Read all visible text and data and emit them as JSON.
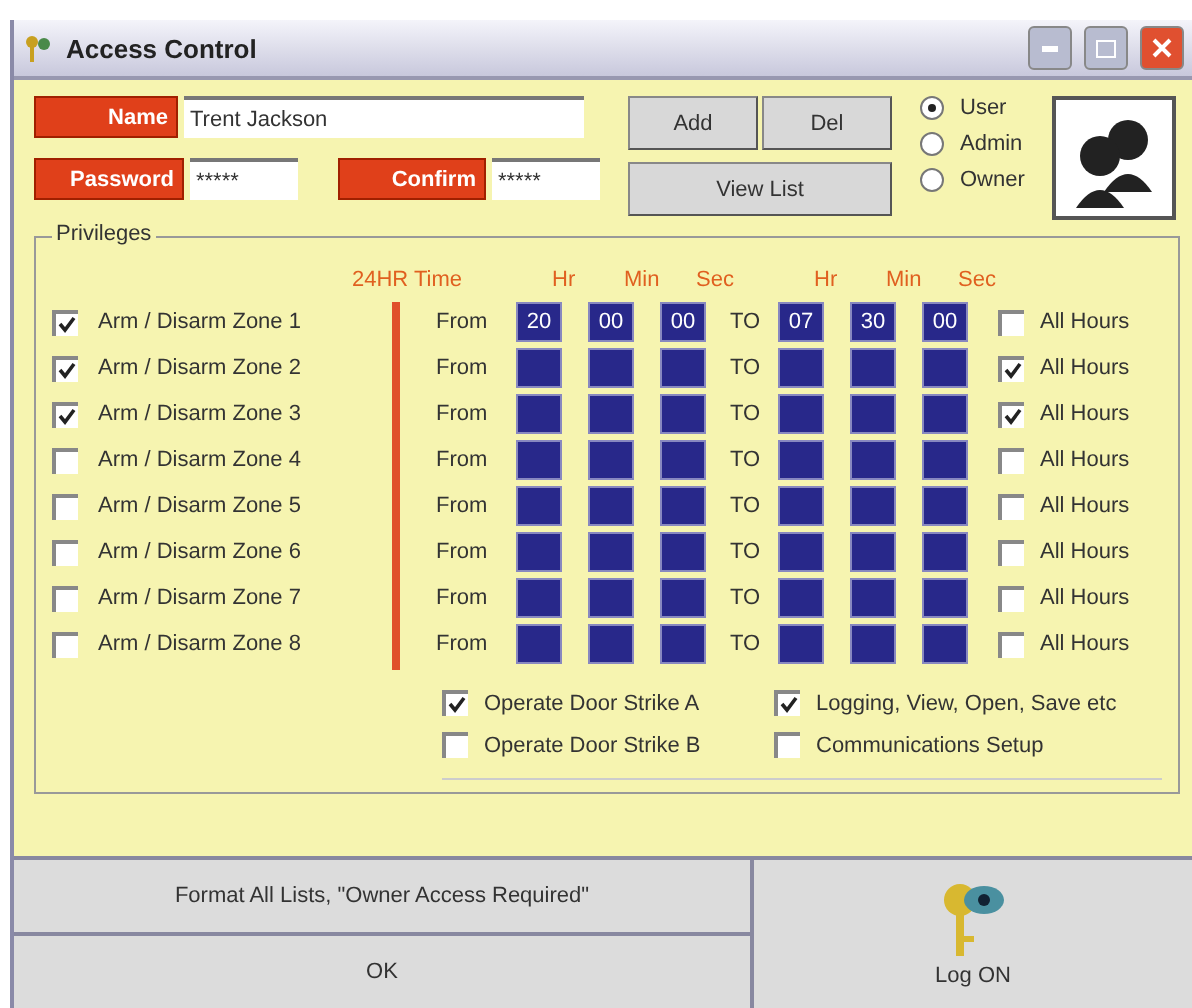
{
  "window": {
    "title": "Access Control"
  },
  "user": {
    "name_label": "Name",
    "name": "Trent Jackson",
    "password_label": "Password",
    "password": "*****",
    "confirm_label": "Confirm",
    "confirm": "*****"
  },
  "buttons": {
    "add": "Add",
    "del": "Del",
    "view_list": "View List"
  },
  "roles": [
    {
      "label": "User",
      "selected": true
    },
    {
      "label": "Admin",
      "selected": false
    },
    {
      "label": "Owner",
      "selected": false
    }
  ],
  "privileges": {
    "title": "Privileges",
    "time_header": "24HR Time",
    "from_headers": [
      "Hr",
      "Min",
      "Sec"
    ],
    "to_headers": [
      "Hr",
      "Min",
      "Sec"
    ],
    "zones": [
      {
        "label": "Arm / Disarm Zone 1",
        "checked": true,
        "from_label": "From",
        "from": [
          "20",
          "00",
          "00"
        ],
        "to_label": "TO",
        "to": [
          "07",
          "30",
          "00"
        ],
        "all_hours_label": "All Hours",
        "all_hours": false
      },
      {
        "label": "Arm / Disarm Zone 2",
        "checked": true,
        "from_label": "From",
        "to_label": "TO",
        "all_hours_label": "All Hours",
        "all_hours": true
      },
      {
        "label": "Arm / Disarm Zone 3",
        "checked": true,
        "from_label": "From",
        "to_label": "TO",
        "all_hours_label": "All Hours",
        "all_hours": true
      },
      {
        "label": "Arm / Disarm Zone 4",
        "checked": false,
        "from_label": "From",
        "to_label": "TO",
        "all_hours_label": "All Hours",
        "all_hours": false
      },
      {
        "label": "Arm / Disarm Zone 5",
        "checked": false,
        "from_label": "From",
        "to_label": "TO",
        "all_hours_label": "All Hours",
        "all_hours": false
      },
      {
        "label": "Arm / Disarm Zone 6",
        "checked": false,
        "from_label": "From",
        "to_label": "TO",
        "all_hours_label": "All Hours",
        "all_hours": false
      },
      {
        "label": "Arm / Disarm Zone 7",
        "checked": false,
        "from_label": "From",
        "to_label": "TO",
        "all_hours_label": "All Hours",
        "all_hours": false
      },
      {
        "label": "Arm / Disarm Zone 8",
        "checked": false,
        "from_label": "From",
        "to_label": "TO",
        "all_hours_label": "All Hours",
        "all_hours": false
      }
    ],
    "options": [
      {
        "label": "Operate Door Strike A",
        "checked": true
      },
      {
        "label": "Logging, View, Open, Save etc",
        "checked": true
      },
      {
        "label": "Operate Door Strike B",
        "checked": false
      },
      {
        "label": "Communications Setup",
        "checked": false
      }
    ]
  },
  "footer": {
    "format": "Format All Lists, \"Owner Access Required\"",
    "ok": "OK",
    "log_on": "Log ON"
  }
}
